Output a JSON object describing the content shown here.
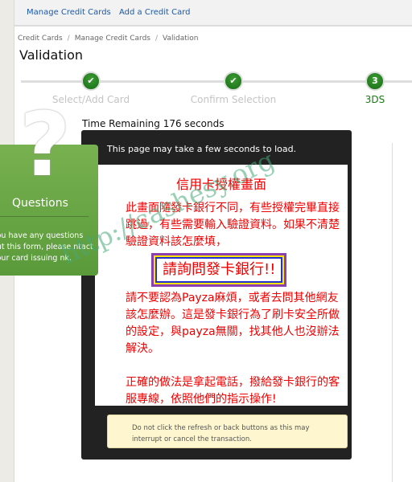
{
  "topnav": {
    "links": [
      "Manage Credit Cards",
      "Add a Credit Card"
    ]
  },
  "breadcrumb": [
    "Credit Cards",
    "Manage Credit Cards",
    "Validation"
  ],
  "breadcrumb_sep": "/",
  "page_title": "Validation",
  "steps": [
    {
      "label": "Select/Add Card",
      "status": "complete",
      "icon": "check-icon"
    },
    {
      "label": "Confirm Selection",
      "status": "complete",
      "icon": "check-icon"
    },
    {
      "label": "3DS",
      "status": "active",
      "number": "3"
    }
  ],
  "time_remaining": "Time Remaining 176 seconds",
  "load_message": "This page may take a few seconds to load.",
  "bank_frame": {
    "heading": "信用卡授權畫面",
    "para1": "此畫面隨發卡銀行不同，有些授權完畢直接跳過，有些需要輸入驗證資料。如果不清楚驗證資料該怎麼填，",
    "highlight": "請詢問發卡銀行!!",
    "para2": "請不要認為Payza麻煩，或者去問其他網友該怎麼辦。這是發卡銀行為了刷卡安全所做的設定，與payza無關，找其他人也沒辦法解決。",
    "para3": "正確的做法是拿起電話，撥給發卡銀行的客服專線，依照他們的指示操作!"
  },
  "note": "Do not click the refresh or back buttons as this may interrupt or cancel the transaction.",
  "questions": {
    "mark": "?",
    "title": "Questions",
    "text": "you have any questions out this form, please ntact your card issuing nk."
  },
  "watermark": "http://cashesy.org",
  "colors": {
    "link": "#1a5aa8",
    "step_green": "#1a7a14",
    "panel_green": "#6aa646",
    "alert_red": "#e00000"
  }
}
